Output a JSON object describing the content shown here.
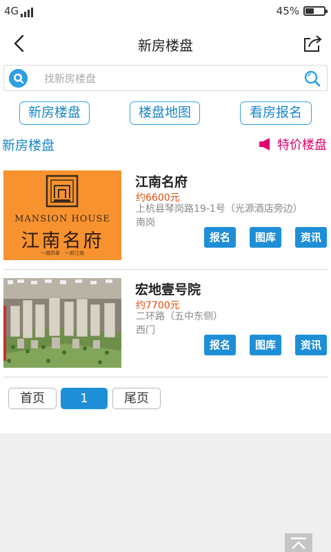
{
  "status_bar": {
    "network": "4G",
    "battery_text": "45%",
    "battery_level": 0.45
  },
  "header": {
    "title": "新房楼盘"
  },
  "search": {
    "placeholder": "找新房楼盘"
  },
  "tabs": [
    {
      "label": "新房楼盘"
    },
    {
      "label": "楼盘地图"
    },
    {
      "label": "看房报名"
    }
  ],
  "section": {
    "title": "新房楼盘",
    "special_label": "特价楼盘"
  },
  "listings": [
    {
      "name": "江南名府",
      "price": "约6600元",
      "address": "上杭县琴岗路19-1号（光源酒店旁边）",
      "area": "南岗",
      "logo_en": "MANSION HOUSE",
      "logo_cn": "江南名府",
      "logo_tag": "一城供奉　一府江南",
      "buttons": [
        "报名",
        "图库",
        "资讯"
      ]
    },
    {
      "name": "宏地壹号院",
      "price": "约7700元",
      "address": "二环路（五中东侧）",
      "area": "西门",
      "buttons": [
        "报名",
        "图库",
        "资讯"
      ]
    }
  ],
  "pagination": {
    "first": "首页",
    "current": "1",
    "last": "尾页"
  },
  "colors": {
    "accent": "#1e8fd6",
    "price": "#e24a0c",
    "special": "#e4006e",
    "logo_bg": "#f7922e"
  },
  "icons": {
    "back": "chevron-left-icon",
    "share": "share-icon",
    "search_logo": "search-logo-icon",
    "search": "magnifier-icon",
    "special": "megaphone-icon",
    "to_top": "back-to-top-icon"
  }
}
